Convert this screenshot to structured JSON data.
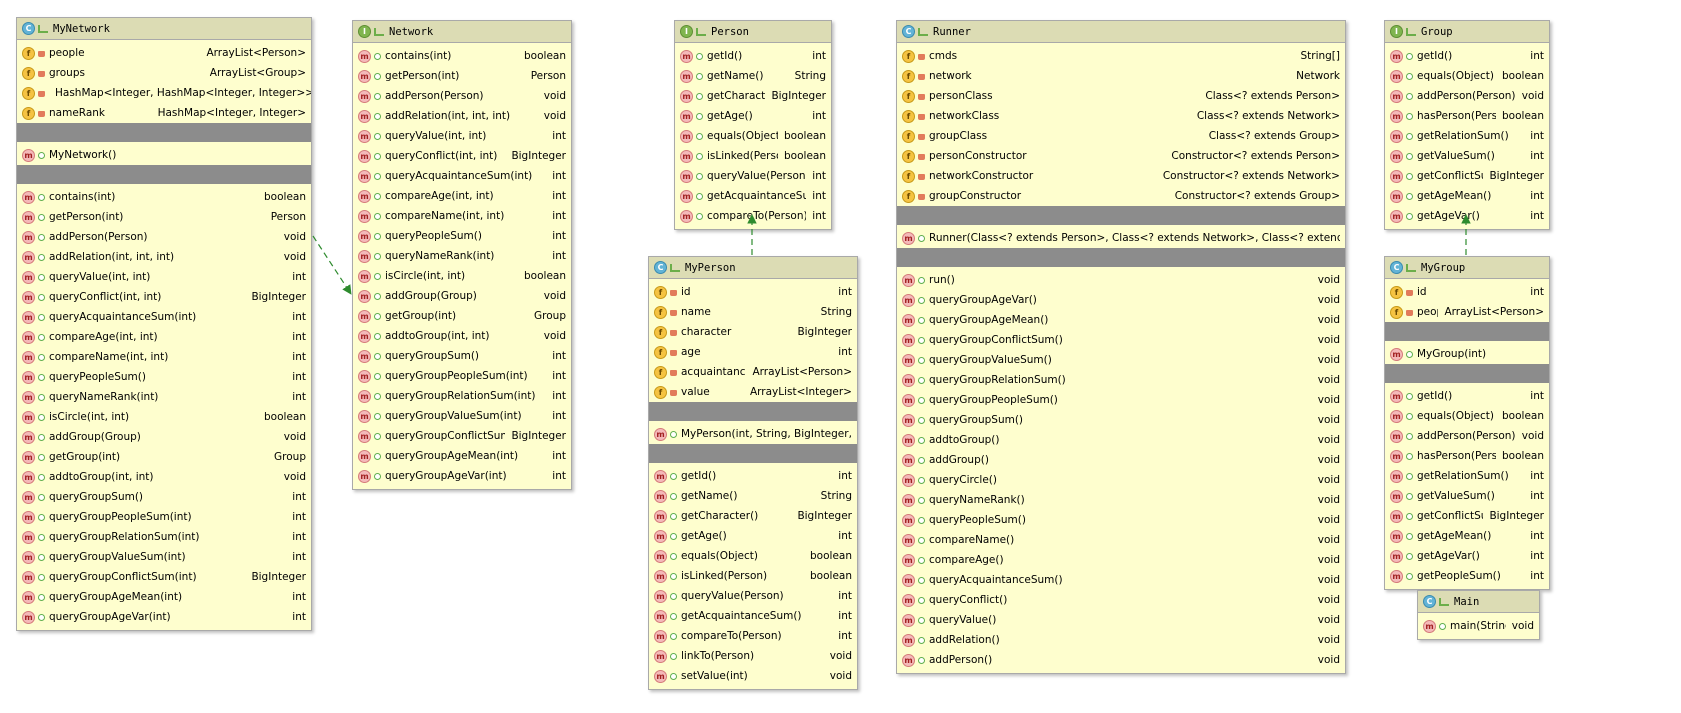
{
  "classes": {
    "mynetwork": {
      "name": "MyNetwork",
      "kind": "C",
      "fields": [
        {
          "name": "people",
          "type": "ArrayList<Person>"
        },
        {
          "name": "groups",
          "type": "ArrayList<Group>"
        },
        {
          "name": "circle",
          "type": "HashMap<Integer, HashMap<Integer, Integer>>"
        },
        {
          "name": "nameRank",
          "type": "HashMap<Integer, Integer>"
        }
      ],
      "constructors": [
        {
          "name": "MyNetwork()",
          "type": ""
        }
      ],
      "methods": [
        {
          "name": "contains(int)",
          "type": "boolean"
        },
        {
          "name": "getPerson(int)",
          "type": "Person"
        },
        {
          "name": "addPerson(Person)",
          "type": "void"
        },
        {
          "name": "addRelation(int, int, int)",
          "type": "void"
        },
        {
          "name": "queryValue(int, int)",
          "type": "int"
        },
        {
          "name": "queryConflict(int, int)",
          "type": "BigInteger"
        },
        {
          "name": "queryAcquaintanceSum(int)",
          "type": "int"
        },
        {
          "name": "compareAge(int, int)",
          "type": "int"
        },
        {
          "name": "compareName(int, int)",
          "type": "int"
        },
        {
          "name": "queryPeopleSum()",
          "type": "int"
        },
        {
          "name": "queryNameRank(int)",
          "type": "int"
        },
        {
          "name": "isCircle(int, int)",
          "type": "boolean"
        },
        {
          "name": "addGroup(Group)",
          "type": "void"
        },
        {
          "name": "getGroup(int)",
          "type": "Group"
        },
        {
          "name": "addtoGroup(int, int)",
          "type": "void"
        },
        {
          "name": "queryGroupSum()",
          "type": "int"
        },
        {
          "name": "queryGroupPeopleSum(int)",
          "type": "int"
        },
        {
          "name": "queryGroupRelationSum(int)",
          "type": "int"
        },
        {
          "name": "queryGroupValueSum(int)",
          "type": "int"
        },
        {
          "name": "queryGroupConflictSum(int)",
          "type": "BigInteger"
        },
        {
          "name": "queryGroupAgeMean(int)",
          "type": "int"
        },
        {
          "name": "queryGroupAgeVar(int)",
          "type": "int"
        }
      ]
    },
    "network": {
      "name": "Network",
      "kind": "I",
      "methods": [
        {
          "name": "contains(int)",
          "type": "boolean"
        },
        {
          "name": "getPerson(int)",
          "type": "Person"
        },
        {
          "name": "addPerson(Person)",
          "type": "void"
        },
        {
          "name": "addRelation(int, int, int)",
          "type": "void"
        },
        {
          "name": "queryValue(int, int)",
          "type": "int"
        },
        {
          "name": "queryConflict(int, int)",
          "type": "BigInteger"
        },
        {
          "name": "queryAcquaintanceSum(int)",
          "type": "int"
        },
        {
          "name": "compareAge(int, int)",
          "type": "int"
        },
        {
          "name": "compareName(int, int)",
          "type": "int"
        },
        {
          "name": "queryPeopleSum()",
          "type": "int"
        },
        {
          "name": "queryNameRank(int)",
          "type": "int"
        },
        {
          "name": "isCircle(int, int)",
          "type": "boolean"
        },
        {
          "name": "addGroup(Group)",
          "type": "void"
        },
        {
          "name": "getGroup(int)",
          "type": "Group"
        },
        {
          "name": "addtoGroup(int, int)",
          "type": "void"
        },
        {
          "name": "queryGroupSum()",
          "type": "int"
        },
        {
          "name": "queryGroupPeopleSum(int)",
          "type": "int"
        },
        {
          "name": "queryGroupRelationSum(int)",
          "type": "int"
        },
        {
          "name": "queryGroupValueSum(int)",
          "type": "int"
        },
        {
          "name": "queryGroupConflictSum(int)",
          "type": "BigInteger"
        },
        {
          "name": "queryGroupAgeMean(int)",
          "type": "int"
        },
        {
          "name": "queryGroupAgeVar(int)",
          "type": "int"
        }
      ]
    },
    "person": {
      "name": "Person",
      "kind": "I",
      "methods": [
        {
          "name": "getId()",
          "type": "int"
        },
        {
          "name": "getName()",
          "type": "String"
        },
        {
          "name": "getCharacter()",
          "type": "BigInteger"
        },
        {
          "name": "getAge()",
          "type": "int"
        },
        {
          "name": "equals(Object)",
          "type": "boolean"
        },
        {
          "name": "isLinked(Person)",
          "type": "boolean"
        },
        {
          "name": "queryValue(Person)",
          "type": "int"
        },
        {
          "name": "getAcquaintanceSum()",
          "type": "int"
        },
        {
          "name": "compareTo(Person)",
          "type": "int"
        }
      ]
    },
    "myperson": {
      "name": "MyPerson",
      "kind": "C",
      "fields": [
        {
          "name": "id",
          "type": "int"
        },
        {
          "name": "name",
          "type": "String"
        },
        {
          "name": "character",
          "type": "BigInteger"
        },
        {
          "name": "age",
          "type": "int"
        },
        {
          "name": "acquaintance",
          "type": "ArrayList<Person>"
        },
        {
          "name": "value",
          "type": "ArrayList<Integer>"
        }
      ],
      "constructors": [
        {
          "name": "MyPerson(int, String, BigInteger, int)",
          "type": ""
        }
      ],
      "methods": [
        {
          "name": "getId()",
          "type": "int"
        },
        {
          "name": "getName()",
          "type": "String"
        },
        {
          "name": "getCharacter()",
          "type": "BigInteger"
        },
        {
          "name": "getAge()",
          "type": "int"
        },
        {
          "name": "equals(Object)",
          "type": "boolean"
        },
        {
          "name": "isLinked(Person)",
          "type": "boolean"
        },
        {
          "name": "queryValue(Person)",
          "type": "int"
        },
        {
          "name": "getAcquaintanceSum()",
          "type": "int"
        },
        {
          "name": "compareTo(Person)",
          "type": "int"
        },
        {
          "name": "linkTo(Person)",
          "type": "void"
        },
        {
          "name": "setValue(int)",
          "type": "void"
        }
      ]
    },
    "runner": {
      "name": "Runner",
      "kind": "C",
      "fields": [
        {
          "name": "cmds",
          "type": "String[]"
        },
        {
          "name": "network",
          "type": "Network"
        },
        {
          "name": "personClass",
          "type": "Class<? extends Person>"
        },
        {
          "name": "networkClass",
          "type": "Class<? extends Network>"
        },
        {
          "name": "groupClass",
          "type": "Class<? extends Group>"
        },
        {
          "name": "personConstructor",
          "type": "Constructor<? extends Person>"
        },
        {
          "name": "networkConstructor",
          "type": "Constructor<? extends Network>"
        },
        {
          "name": "groupConstructor",
          "type": "Constructor<? extends Group>"
        }
      ],
      "constructors": [
        {
          "name": "Runner(Class<? extends Person>, Class<? extends Network>, Class<? extends Group>)",
          "type": ""
        }
      ],
      "methods": [
        {
          "name": "run()",
          "type": "void"
        },
        {
          "name": "queryGroupAgeVar()",
          "type": "void"
        },
        {
          "name": "queryGroupAgeMean()",
          "type": "void"
        },
        {
          "name": "queryGroupConflictSum()",
          "type": "void"
        },
        {
          "name": "queryGroupValueSum()",
          "type": "void"
        },
        {
          "name": "queryGroupRelationSum()",
          "type": "void"
        },
        {
          "name": "queryGroupPeopleSum()",
          "type": "void"
        },
        {
          "name": "queryGroupSum()",
          "type": "void"
        },
        {
          "name": "addtoGroup()",
          "type": "void"
        },
        {
          "name": "addGroup()",
          "type": "void"
        },
        {
          "name": "queryCircle()",
          "type": "void"
        },
        {
          "name": "queryNameRank()",
          "type": "void"
        },
        {
          "name": "queryPeopleSum()",
          "type": "void"
        },
        {
          "name": "compareName()",
          "type": "void"
        },
        {
          "name": "compareAge()",
          "type": "void"
        },
        {
          "name": "queryAcquaintanceSum()",
          "type": "void"
        },
        {
          "name": "queryConflict()",
          "type": "void"
        },
        {
          "name": "queryValue()",
          "type": "void"
        },
        {
          "name": "addRelation()",
          "type": "void"
        },
        {
          "name": "addPerson()",
          "type": "void"
        }
      ]
    },
    "group": {
      "name": "Group",
      "kind": "I",
      "methods": [
        {
          "name": "getId()",
          "type": "int"
        },
        {
          "name": "equals(Object)",
          "type": "boolean"
        },
        {
          "name": "addPerson(Person)",
          "type": "void"
        },
        {
          "name": "hasPerson(Person)",
          "type": "boolean"
        },
        {
          "name": "getRelationSum()",
          "type": "int"
        },
        {
          "name": "getValueSum()",
          "type": "int"
        },
        {
          "name": "getConflictSum()",
          "type": "BigInteger"
        },
        {
          "name": "getAgeMean()",
          "type": "int"
        },
        {
          "name": "getAgeVar()",
          "type": "int"
        }
      ]
    },
    "mygroup": {
      "name": "MyGroup",
      "kind": "C",
      "fields": [
        {
          "name": "id",
          "type": "int"
        },
        {
          "name": "people",
          "type": "ArrayList<Person>"
        }
      ],
      "constructors": [
        {
          "name": "MyGroup(int)",
          "type": ""
        }
      ],
      "methods": [
        {
          "name": "getId()",
          "type": "int"
        },
        {
          "name": "equals(Object)",
          "type": "boolean"
        },
        {
          "name": "addPerson(Person)",
          "type": "void"
        },
        {
          "name": "hasPerson(Person)",
          "type": "boolean"
        },
        {
          "name": "getRelationSum()",
          "type": "int"
        },
        {
          "name": "getValueSum()",
          "type": "int"
        },
        {
          "name": "getConflictSum()",
          "type": "BigInteger"
        },
        {
          "name": "getAgeMean()",
          "type": "int"
        },
        {
          "name": "getAgeVar()",
          "type": "int"
        },
        {
          "name": "getPeopleSum()",
          "type": "int"
        }
      ]
    },
    "main": {
      "name": "Main",
      "kind": "C",
      "methods": [
        {
          "name": "main(String[])",
          "type": "void"
        }
      ]
    }
  },
  "colors": {
    "box_fill": "#fefece",
    "header_fill": "#dcdcb4",
    "separator": "#8c8c8c",
    "arrow": "#2e8b2e"
  },
  "icons": {
    "field": "field-icon",
    "method": "method-icon",
    "class": "class-icon",
    "interface": "interface-icon"
  }
}
